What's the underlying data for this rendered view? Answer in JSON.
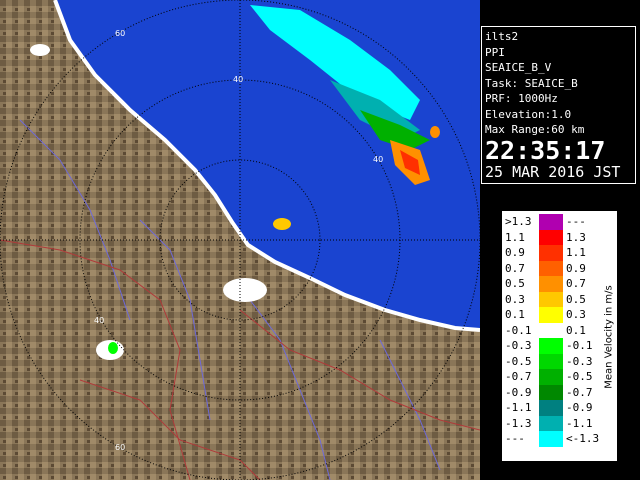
{
  "info": {
    "site": "ilts2",
    "scan": "PPI",
    "product": "SEAICE_B_V",
    "task": "Task: SEAICE_B",
    "prf": "PRF: 1000Hz",
    "elevation": "Elevation:1.0",
    "max_range": "Max Range:60 km",
    "time": "22:35:17",
    "date": "25 MAR 2016 JST"
  },
  "legend": {
    "title": "Mean Velocity in m/s",
    "rows": [
      {
        "lo": ">1.3",
        "hi": "---",
        "color": "#b000b0"
      },
      {
        "lo": "1.1",
        "hi": "1.3",
        "color": "#ff0000"
      },
      {
        "lo": "0.9",
        "hi": "1.1",
        "color": "#ff3000"
      },
      {
        "lo": "0.7",
        "hi": "0.9",
        "color": "#ff6000"
      },
      {
        "lo": "0.5",
        "hi": "0.7",
        "color": "#ff9000"
      },
      {
        "lo": "0.3",
        "hi": "0.5",
        "color": "#ffc800"
      },
      {
        "lo": "0.1",
        "hi": "0.3",
        "color": "#ffff00"
      },
      {
        "lo": "-0.1",
        "hi": "0.1",
        "color": "#ffffff"
      },
      {
        "lo": "-0.3",
        "hi": "-0.1",
        "color": "#00ff00"
      },
      {
        "lo": "-0.5",
        "hi": "-0.3",
        "color": "#00d800"
      },
      {
        "lo": "-0.7",
        "hi": "-0.5",
        "color": "#00b000"
      },
      {
        "lo": "-0.9",
        "hi": "-0.7",
        "color": "#008800"
      },
      {
        "lo": "-1.1",
        "hi": "-0.9",
        "color": "#008080"
      },
      {
        "lo": "-1.3",
        "hi": "-1.1",
        "color": "#00b0b0"
      },
      {
        "lo": "---",
        "hi": "<-1.3",
        "color": "#00ffff"
      }
    ]
  },
  "range_rings": {
    "labels": [
      "60",
      "40",
      "40",
      "40",
      "60"
    ]
  },
  "colors": {
    "sea": "#1a44d0",
    "land": "#8a7658",
    "coast": "#ffffff",
    "ring": "#000000"
  }
}
